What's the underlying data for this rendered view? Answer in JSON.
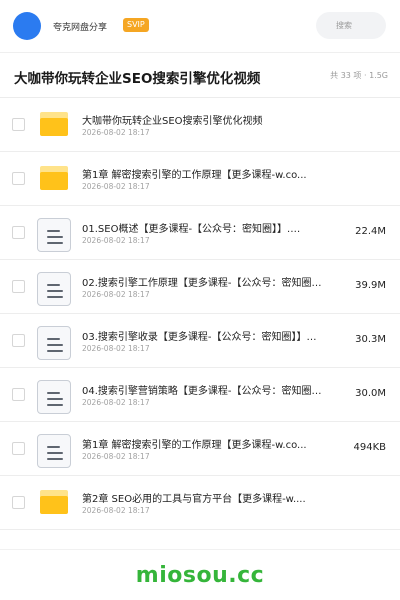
{
  "header": {
    "brand": "夸克网盘分享",
    "badge": "SVIP",
    "search_placeholder": "搜索"
  },
  "share": {
    "title": "大咖带你玩转企业SEO搜索引擎优化视频",
    "meta": "共 33 项 · 1.5G"
  },
  "files": [
    {
      "type": "folder",
      "name": "大咖带你玩转企业SEO搜索引擎优化视频",
      "date": "2026-08-02 18:17",
      "size": ""
    },
    {
      "type": "folder",
      "name": "第1章 解密搜索引擎的工作原理【更多课程-w.co...",
      "date": "2026-08-02 18:17",
      "size": ""
    },
    {
      "type": "doc",
      "name": "01.SEO概述【更多课程-【公众号：密知圈】】.…",
      "date": "2026-08-02 18:17",
      "size": "22.4M"
    },
    {
      "type": "doc",
      "name": "02.搜索引擎工作原理【更多课程-【公众号：密知圈…",
      "date": "2026-08-02 18:17",
      "size": "39.9M"
    },
    {
      "type": "doc",
      "name": "03.搜索引擎收录【更多课程-【公众号：密知圈】】…",
      "date": "2026-08-02 18:17",
      "size": "30.3M"
    },
    {
      "type": "doc",
      "name": "04.搜索引擎营销策略【更多课程-【公众号：密知圈…",
      "date": "2026-08-02 18:17",
      "size": "30.0M"
    },
    {
      "type": "doc",
      "name": "第1章 解密搜索引擎的工作原理【更多课程-w.co...",
      "date": "2026-08-02 18:17",
      "size": "494KB"
    },
    {
      "type": "folder",
      "name": "第2章 SEO必用的工具与官方平台【更多课程-w....",
      "date": "2026-08-02 18:17",
      "size": ""
    }
  ],
  "watermark": "miosou.cc",
  "colors": {
    "accent_blue": "#2b7bf0",
    "svip_orange": "#f5a623",
    "folder_yellow": "#ffc21a",
    "watermark_green": "#35b53a"
  },
  "icons": [
    "avatar",
    "folder-icon",
    "document-icon",
    "checkbox"
  ]
}
